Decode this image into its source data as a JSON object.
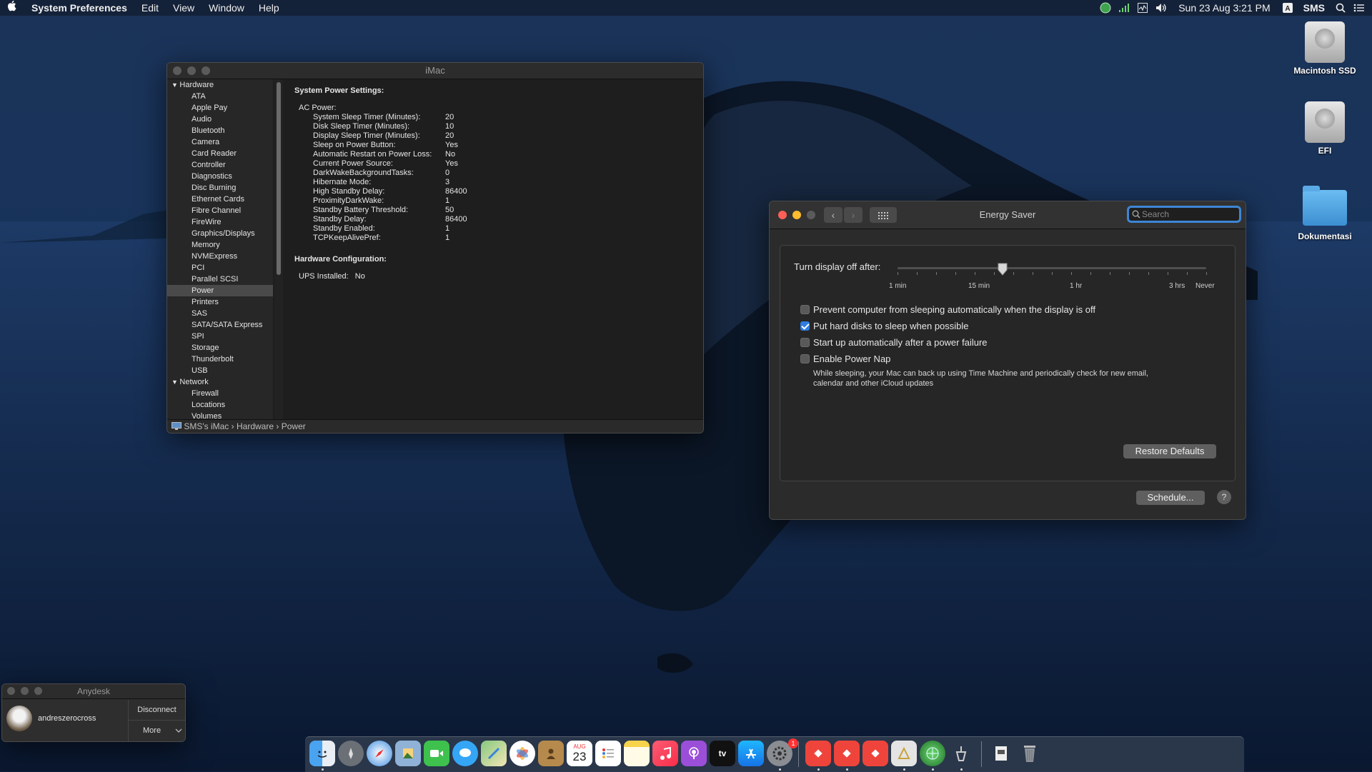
{
  "menubar": {
    "app": "System Preferences",
    "items": [
      "Edit",
      "View",
      "Window",
      "Help"
    ],
    "datetime": "Sun 23 Aug  3:21 PM",
    "user": "SMS"
  },
  "desktop": {
    "icons": [
      {
        "label": "Macintosh SSD"
      },
      {
        "label": "EFI"
      },
      {
        "label": "Dokumentasi"
      }
    ]
  },
  "sysinfo": {
    "title": "iMac",
    "sidebar": [
      {
        "type": "group",
        "label": "Hardware"
      },
      {
        "type": "item",
        "label": "ATA"
      },
      {
        "type": "item",
        "label": "Apple Pay"
      },
      {
        "type": "item",
        "label": "Audio"
      },
      {
        "type": "item",
        "label": "Bluetooth"
      },
      {
        "type": "item",
        "label": "Camera"
      },
      {
        "type": "item",
        "label": "Card Reader"
      },
      {
        "type": "item",
        "label": "Controller"
      },
      {
        "type": "item",
        "label": "Diagnostics"
      },
      {
        "type": "item",
        "label": "Disc Burning"
      },
      {
        "type": "item",
        "label": "Ethernet Cards"
      },
      {
        "type": "item",
        "label": "Fibre Channel"
      },
      {
        "type": "item",
        "label": "FireWire"
      },
      {
        "type": "item",
        "label": "Graphics/Displays"
      },
      {
        "type": "item",
        "label": "Memory"
      },
      {
        "type": "item",
        "label": "NVMExpress"
      },
      {
        "type": "item",
        "label": "PCI"
      },
      {
        "type": "item",
        "label": "Parallel SCSI"
      },
      {
        "type": "item",
        "label": "Power",
        "selected": true
      },
      {
        "type": "item",
        "label": "Printers"
      },
      {
        "type": "item",
        "label": "SAS"
      },
      {
        "type": "item",
        "label": "SATA/SATA Express"
      },
      {
        "type": "item",
        "label": "SPI"
      },
      {
        "type": "item",
        "label": "Storage"
      },
      {
        "type": "item",
        "label": "Thunderbolt"
      },
      {
        "type": "item",
        "label": "USB"
      },
      {
        "type": "group",
        "label": "Network"
      },
      {
        "type": "item",
        "label": "Firewall"
      },
      {
        "type": "item",
        "label": "Locations"
      },
      {
        "type": "item",
        "label": "Volumes"
      }
    ],
    "heading": "System Power Settings:",
    "ac_label": "AC Power:",
    "settings": [
      {
        "k": "System Sleep Timer (Minutes):",
        "v": "20"
      },
      {
        "k": "Disk Sleep Timer (Minutes):",
        "v": "10"
      },
      {
        "k": "Display Sleep Timer (Minutes):",
        "v": "20"
      },
      {
        "k": "Sleep on Power Button:",
        "v": "Yes"
      },
      {
        "k": "Automatic Restart on Power Loss:",
        "v": "No"
      },
      {
        "k": "Current Power Source:",
        "v": "Yes"
      },
      {
        "k": "DarkWakeBackgroundTasks:",
        "v": "0"
      },
      {
        "k": "Hibernate Mode:",
        "v": "3"
      },
      {
        "k": "High Standby Delay:",
        "v": "86400"
      },
      {
        "k": "ProximityDarkWake:",
        "v": "1"
      },
      {
        "k": "Standby Battery Threshold:",
        "v": "50"
      },
      {
        "k": "Standby Delay:",
        "v": "86400"
      },
      {
        "k": "Standby Enabled:",
        "v": "1"
      },
      {
        "k": "TCPKeepAlivePref:",
        "v": "1"
      }
    ],
    "hw_heading": "Hardware Configuration:",
    "ups_label": "UPS Installed:",
    "ups_value": "No",
    "path": [
      "SMS's iMac",
      "Hardware",
      "Power"
    ]
  },
  "energy": {
    "title": "Energy Saver",
    "search_placeholder": "Search",
    "slider_label": "Turn display off after:",
    "slider_value_fraction": 0.34,
    "ticks": [
      "1 min",
      "15 min",
      "1 hr",
      "3 hrs",
      "Never"
    ],
    "options": [
      {
        "label": "Prevent computer from sleeping automatically when the display is off",
        "checked": false
      },
      {
        "label": "Put hard disks to sleep when possible",
        "checked": true
      },
      {
        "label": "Start up automatically after a power failure",
        "checked": false
      },
      {
        "label": "Enable Power Nap",
        "checked": false
      }
    ],
    "powernap_desc1": "While sleeping, your Mac can back up using Time Machine and periodically check for new email,",
    "powernap_desc2": "calendar and other iCloud updates",
    "restore_btn": "Restore Defaults",
    "schedule_btn": "Schedule...",
    "help": "?"
  },
  "anydesk": {
    "title": "Anydesk",
    "user": "andreszerocross",
    "disconnect": "Disconnect",
    "more": "More"
  },
  "dock": {
    "calendar_month": "AUG",
    "calendar_day": "23",
    "sysprefs_badge": "1",
    "appletv": "tv"
  }
}
